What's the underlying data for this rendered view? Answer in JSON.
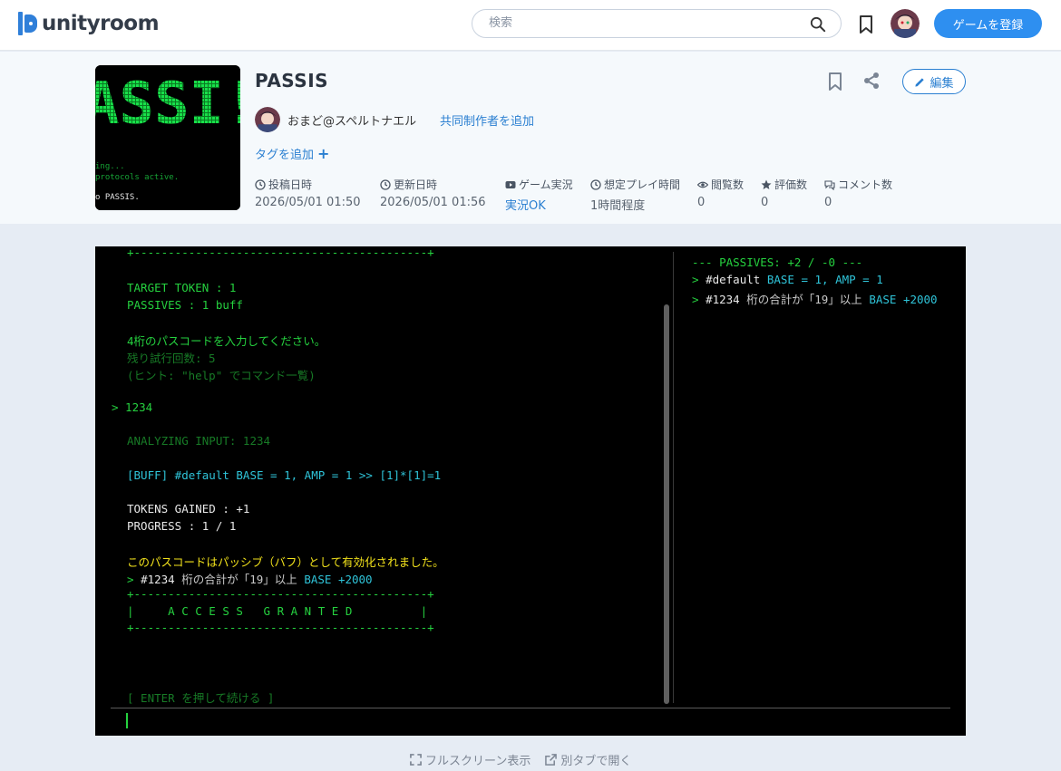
{
  "site": {
    "logo_text": "unityroom",
    "brand_color": "#2f7fd9"
  },
  "search": {
    "placeholder": "検索",
    "value": ""
  },
  "topbar": {
    "register_label": "ゲームを登録"
  },
  "game": {
    "title": "PASSIS",
    "author": "おまど@スペルトナエル",
    "coauthor_link": "共同制作者を追加",
    "tag_add": "タグを追加",
    "edit_label": "編集",
    "thumbnail": {
      "big_text": "ASSI!",
      "line1": "ing...",
      "line2": "protocols active.",
      "line3": "o PASSIS."
    }
  },
  "stats": [
    {
      "label": "投稿日時",
      "value": "2026/05/01 01:50",
      "icon": "clock-icon"
    },
    {
      "label": "更新日時",
      "value": "2026/05/01 01:56",
      "icon": "clock-icon"
    },
    {
      "label": "ゲーム実況",
      "value": "実況OK",
      "icon": "youtube-icon"
    },
    {
      "label": "想定プレイ時間",
      "value": "1時間程度",
      "icon": "clock-icon"
    },
    {
      "label": "閲覧数",
      "value": "0",
      "icon": "eye-icon"
    },
    {
      "label": "評価数",
      "value": "0",
      "icon": "star-icon"
    },
    {
      "label": "コメント数",
      "value": "0",
      "icon": "comment-icon"
    }
  ],
  "terminal": {
    "border_top_partial": "+-------------------------------------------+",
    "target_token": "TARGET TOKEN : 1",
    "passives": "PASSIVES : 1 buff",
    "prompt_msg": "4桁のパスコードを入力してください。",
    "attempts": "残り試行回数: 5",
    "hint": "(ヒント: \"help\" でコマンド一覧)",
    "input_echo": "> 1234",
    "analyzing": "ANALYZING INPUT: 1234",
    "buff_line": "[BUFF] #default BASE = 1, AMP = 1 >> [1]*[1]=1",
    "tokens_gained": "TOKENS GAINED : +1",
    "progress": "PROGRESS : 1 / 1",
    "activated_msg": "このパスコードはパッシブ（バフ）として有効化されました。",
    "passive_arrow": ">",
    "passive_id": "#1234",
    "passive_desc": "桁の合計が「19」以上",
    "passive_effect": "BASE +2000",
    "box_border": "+-------------------------------------------+",
    "box_middle": "|     A C C E S S   G R A N T E D          |",
    "enter_prompt": "[ ENTER を押して続ける ]"
  },
  "side_panel": {
    "header": "--- PASSIVES: +2 / -0 ---",
    "items": [
      {
        "arrow": ">",
        "id": "#default",
        "effect": "BASE = 1, AMP = 1",
        "desc": ""
      },
      {
        "arrow": ">",
        "id": "#1234",
        "desc": "桁の合計が「19」以上",
        "effect": "BASE +2000"
      }
    ]
  },
  "footer": {
    "fullscreen": "フルスクリーン表示",
    "new_tab": "別タブで開く"
  },
  "colors": {
    "terminal_green": "#25d13f",
    "terminal_cyan": "#2fc4d9",
    "terminal_yellow": "#f2e21b",
    "accent_blue": "#2e8ff0"
  }
}
